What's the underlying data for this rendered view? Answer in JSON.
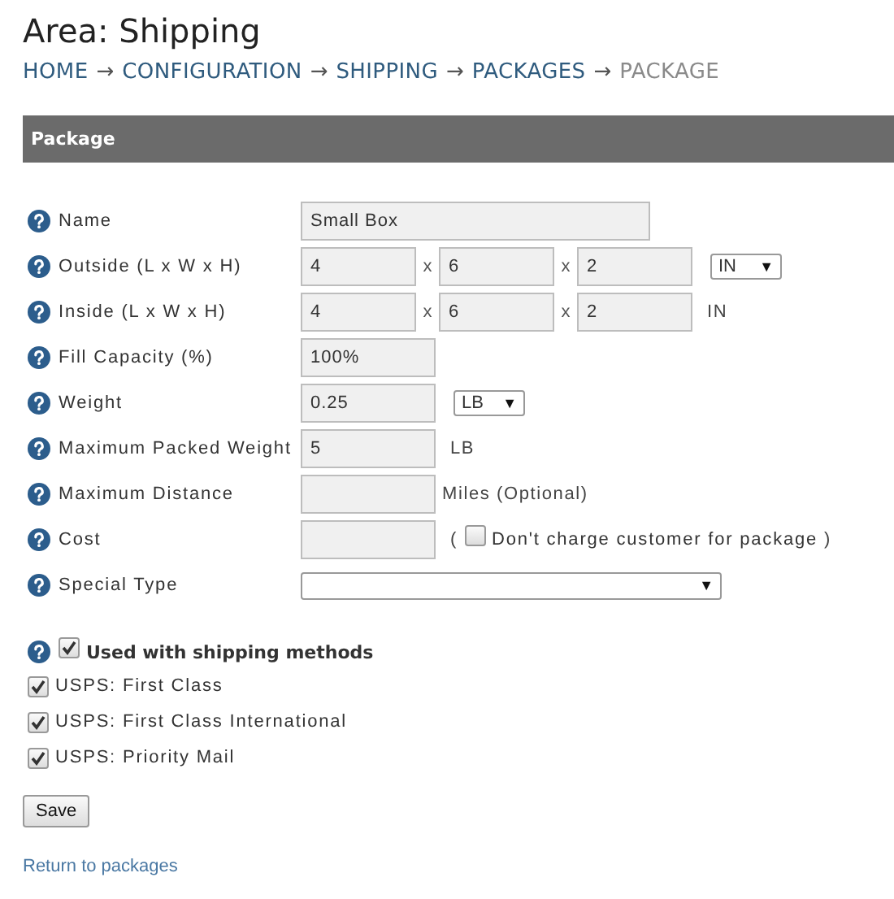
{
  "title": "Area: Shipping",
  "breadcrumb": [
    {
      "label": "HOME",
      "arrow": "→",
      "current": false
    },
    {
      "label": "CONFIGURATION",
      "arrow": "→",
      "current": false
    },
    {
      "label": "SHIPPING",
      "arrow": "→",
      "current": false
    },
    {
      "label": "PACKAGES",
      "arrow": "→",
      "current": false
    },
    {
      "label": "PACKAGE",
      "current": true
    }
  ],
  "panel": {
    "title": "Package"
  },
  "fields": [
    {
      "label": "Name",
      "parts": [
        {
          "kind": "longinput",
          "value": "Small Box"
        }
      ]
    },
    {
      "label": "Outside (L x W x H)",
      "parts": [
        {
          "kind": "dimension",
          "value": "4"
        },
        {
          "kind": "sep",
          "text": "x"
        },
        {
          "kind": "dimension",
          "value": "6"
        },
        {
          "kind": "sep",
          "text": "x"
        },
        {
          "kind": "dimension",
          "value": "2"
        },
        {
          "kind": "select",
          "value": "IN",
          "arrow": "▼"
        }
      ]
    },
    {
      "label": "Inside (L x W x H)",
      "parts": [
        {
          "kind": "dimension",
          "value": "4"
        },
        {
          "kind": "sep",
          "text": "x"
        },
        {
          "kind": "dimension",
          "value": "6"
        },
        {
          "kind": "sep",
          "text": "x"
        },
        {
          "kind": "dimension",
          "value": "2"
        },
        {
          "kind": "unit",
          "text": "IN"
        }
      ]
    },
    {
      "label": "Fill Capacity (%)",
      "parts": [
        {
          "kind": "input",
          "value": "100%"
        }
      ]
    },
    {
      "label": "Weight",
      "parts": [
        {
          "kind": "input",
          "value": "0.25"
        },
        {
          "kind": "select",
          "value": "LB",
          "arrow": "▼"
        }
      ]
    },
    {
      "label": "Maximum Packed Weight",
      "parts": [
        {
          "kind": "input",
          "value": "5"
        },
        {
          "kind": "unit",
          "text": "LB"
        }
      ]
    },
    {
      "label": "Maximum Distance",
      "parts": [
        {
          "kind": "input"
        },
        {
          "kind": "note",
          "text": "Miles (Optional)"
        }
      ]
    },
    {
      "label": "Cost",
      "parts": [
        {
          "kind": "input"
        },
        {
          "kind": "unit",
          "text": "("
        },
        {
          "kind": "checkbox",
          "label": "Don't charge customer for package",
          "checked": false
        },
        {
          "kind": "note",
          "text": ")"
        }
      ]
    },
    {
      "label": "Special Type",
      "parts": [
        {
          "kind": "longselect",
          "arrow": "▼"
        }
      ]
    }
  ],
  "methods_toggle": {
    "label": "Used with shipping methods",
    "checked": true
  },
  "methods": [
    {
      "label": "USPS: First Class",
      "checked": true
    },
    {
      "label": "USPS: First Class International",
      "checked": true
    },
    {
      "label": "USPS: Priority Mail",
      "checked": true
    }
  ],
  "save_button": "Save",
  "return_link": "Return to packages"
}
